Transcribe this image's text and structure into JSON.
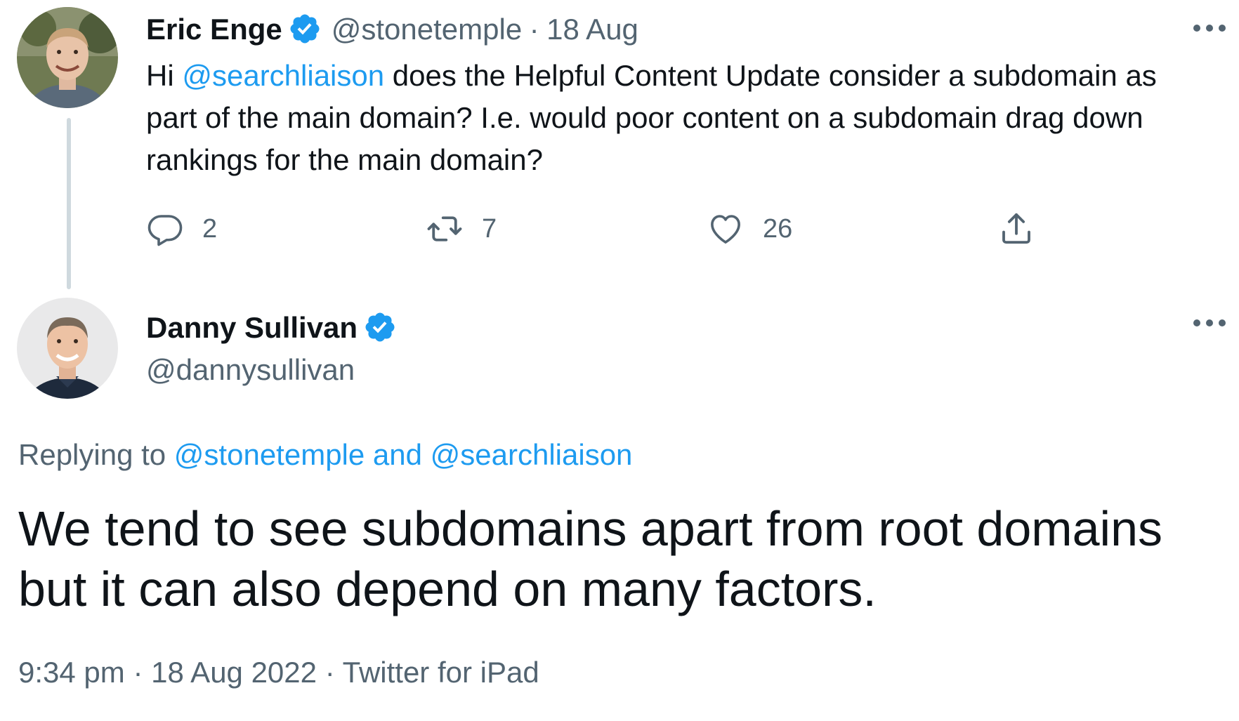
{
  "tweet": {
    "author_name": "Eric Enge",
    "author_handle": "@stonetemple",
    "separator": "·",
    "date": "18 Aug",
    "text_prefix": "Hi ",
    "mention": "@searchliaison",
    "text_suffix": " does the Helpful Content Update consider a subdomain as part of the main domain? I.e. would poor content on a subdomain drag down rankings for the main domain?",
    "reply_count": "2",
    "retweet_count": "7",
    "like_count": "26"
  },
  "reply": {
    "author_name": "Danny Sullivan",
    "author_handle": "@dannysullivan",
    "replying_label": "Replying to",
    "replying_mentions": "@stonetemple and @searchliaison",
    "text": "We tend to see subdomains apart from root domains but it can also depend on many factors.",
    "time": "9:34 pm",
    "separator": "·",
    "date": "18 Aug 2022",
    "source": "Twitter for iPad"
  },
  "colors": {
    "accent": "#1d9bf0",
    "text": "#0f1419",
    "muted": "#536471",
    "thread_line": "#cfd9de"
  },
  "icons": {
    "verified": "verified-badge-icon",
    "more": "more-horizontal-icon",
    "reply": "reply-bubble-icon",
    "retweet": "retweet-icon",
    "like": "heart-icon",
    "share": "share-upload-icon"
  }
}
